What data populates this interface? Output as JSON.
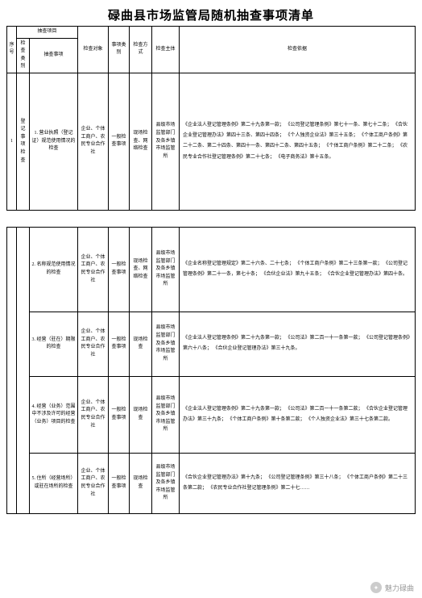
{
  "title": "碌曲县市场监管局随机抽查事项清单",
  "headers": {
    "seq": "序号",
    "category": "检 查 类 别",
    "project_group": "抽查项目",
    "item": "抽查事项",
    "object": "检查对象",
    "type": "事项类别",
    "method": "检查方式",
    "subject": "检查主体",
    "basis": "检查依据"
  },
  "rows": [
    {
      "seq": "1",
      "category": "登记事项检查",
      "item": "1. 营业执照（登记证）规范使用情况的检查",
      "object": "企业、个体工商户、农民专业合作社",
      "type": "一般检查事项",
      "method": "现场检查、网络检查",
      "subject": "县级市场监管部门及各乡镇市场监管所",
      "basis": "《企业法人登记管理条例》第二十九条第一款；\n《公司登记管理条例》第七十一条、第七十二条；\n《合伙企业登记管理办法》第四十三条、第四十四条；\n《个人独资企业法》第三十五条；\n《个体工商户条例》第二十二条、第二十四条、第四十一条、第四十二条、第四十五条；\n《个体工商户条例》第二十二条；\n《农民专业合作社登记管理条例》第二十七条；\n《电子商务法》第十五条。"
    },
    {
      "seq": "",
      "category": "",
      "item": "2. 名称规范使用情况的检查",
      "object": "企业、个体工商户、农民专业合作社",
      "type": "一般检查事项",
      "method": "现场检查、网络检查",
      "subject": "县级市场监管部门及各乡镇市场监管所",
      "basis": "《企业名称登记管理规定》第二十六条、二十七条；\n《个体工商户条例》第二十三条第一款；\n《公司登记管理条例》第二十一条，第七十条；\n《合伙企业法》第九十五条；\n《合伙企业登记管理办法》第四十条。"
    },
    {
      "seq": "",
      "category": "",
      "item": "3. 经营（驻在）期限的检查",
      "object": "企业、个体工商户、农民专业合作社",
      "type": "一般检查事项",
      "method": "现场检查",
      "subject": "县级市场监管部门及各乡镇市场监管所",
      "basis": "《企业法人登记管理条例》第二十九条第一款；\n《公司法》第二百一十一条第一款；\n《公司登记管理条例》第六十八条；\n《合伙企业登记管理办法》第三十九条。"
    },
    {
      "seq": "",
      "category": "",
      "item": "4. 经营（业务）范围中不涉及许可的经营（业务）项目的检查",
      "object": "企业、个体工商户、农民专业合作社",
      "type": "一般检查事项",
      "method": "现场检查",
      "subject": "县级市场监管部门及各乡镇市场监管所",
      "basis": "《企业法人登记管理条例》第二十九条第一款；\n《公司法》第二百一十一条第二款；\n《合伙企业登记管理办法》第三十九条；\n《个体工商户条例》第十条第二款；\n《个人独资企业法》第三十七条第二款。"
    },
    {
      "seq": "",
      "category": "",
      "item": "5. 住所（经营场所）或驻在场所的检查",
      "object": "企业、个体工商户、农民专业合作社",
      "type": "一般检查事项",
      "method": "现场检查",
      "subject": "县级市场监管部门及各乡镇市场监管所",
      "basis": "《合伙企业登记管理办法》第十九条；\n《公司登记管理条例》第三十八条；\n《个体工商户条例》第二十三条第二款；\n《农民专业合作社登记管理条例》第二十七……"
    }
  ],
  "footer": {
    "source": "魅力碌曲"
  }
}
